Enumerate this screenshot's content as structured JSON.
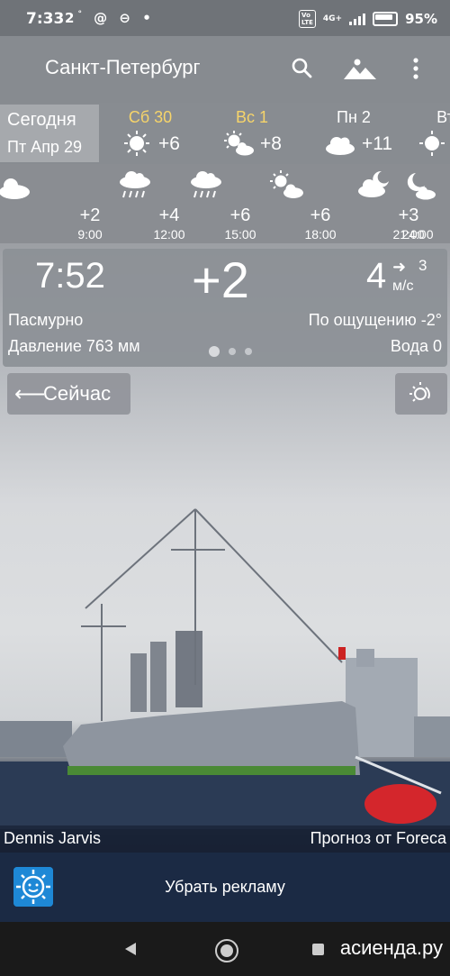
{
  "status_bar": {
    "time": "7:33",
    "left_icons": "2",
    "battery": "95%",
    "network": "4G+"
  },
  "app_bar": {
    "city": "Санкт-Петербург",
    "icons": [
      "search-icon",
      "landscape-icon",
      "more-vert-icon"
    ]
  },
  "days": {
    "today_label": "Сегодня",
    "today_date": "Пт Апр 29",
    "items": [
      {
        "name": "Сб 30",
        "temp": "+6",
        "icon": "sun-icon",
        "weekend": true
      },
      {
        "name": "Вс 1",
        "temp": "+8",
        "icon": "sun-cloud-icon",
        "weekend": true
      },
      {
        "name": "Пн 2",
        "temp": "+11",
        "icon": "cloud-icon",
        "weekend": false
      },
      {
        "name": "Вт",
        "temp": "",
        "icon": "sun-icon",
        "weekend": false
      }
    ]
  },
  "hours": [
    {
      "time": "9:00",
      "temp": "+2",
      "icon": "cloud-icon"
    },
    {
      "time": "12:00",
      "temp": "+4",
      "icon": "rain-icon"
    },
    {
      "time": "15:00",
      "temp": "+6",
      "icon": "rain-icon"
    },
    {
      "time": "18:00",
      "temp": "+6",
      "icon": "sun-cloud-icon"
    },
    {
      "time": "21:00",
      "temp": "+3",
      "icon": "moon-cloud-icon"
    },
    {
      "time": "24:00",
      "temp": "",
      "icon": "moon-cloud-icon"
    }
  ],
  "current": {
    "time": "7:52",
    "temp": "+2",
    "wind_speed": "4",
    "wind_direction": "3",
    "wind_unit": "м/с",
    "condition": "Пасмурно",
    "feels_like": "По ощущению -2°",
    "pressure": "Давление 763 мм",
    "water": "Вода 0",
    "page": 1,
    "pages": 3
  },
  "buttons": {
    "now_label": "Сейчас"
  },
  "credits": {
    "photo_author": "Dennis Jarvis",
    "provider": "Прогноз от Foreca"
  },
  "ad": {
    "label": "Убрать рекламу"
  },
  "watermark": "асиенда.ру",
  "colors": {
    "weekend": "#f6d46a",
    "ad_bar": "#1b2a44",
    "ad_icon": "#1e88d6"
  }
}
